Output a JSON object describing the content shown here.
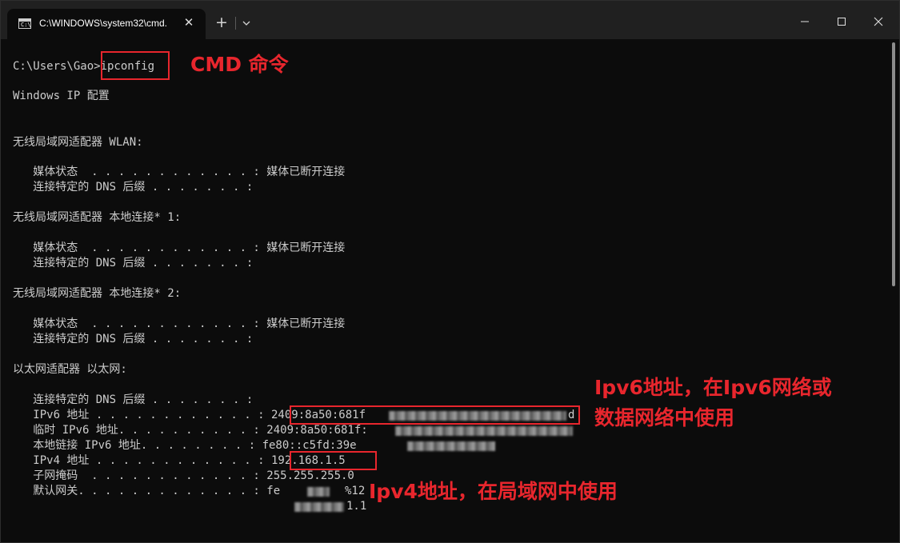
{
  "window": {
    "tab_title": "C:\\WINDOWS\\system32\\cmd.",
    "tab_icon_glyph": "C:\\",
    "close_tab_glyph": "✕",
    "new_tab_glyph": "+"
  },
  "console": {
    "prompt": "C:\\Users\\Gao>",
    "command": "ipconfig",
    "lines": [
      {
        "text": "Windows IP 配置"
      },
      {
        "text": "无线局域网适配器 WLAN:"
      },
      {
        "text": "   媒体状态  . . . . . . . . . . . . : 媒体已断开连接"
      },
      {
        "text": "   连接特定的 DNS 后缀 . . . . . . . :"
      },
      {
        "text": "无线局域网适配器 本地连接* 1:"
      },
      {
        "text": "   媒体状态  . . . . . . . . . . . . : 媒体已断开连接"
      },
      {
        "text": "   连接特定的 DNS 后缀 . . . . . . . :"
      },
      {
        "text": "无线局域网适配器 本地连接* 2:"
      },
      {
        "text": "   媒体状态  . . . . . . . . . . . . : 媒体已断开连接"
      },
      {
        "text": "   连接特定的 DNS 后缀 . . . . . . . :"
      },
      {
        "text": "以太网适配器 以太网:"
      },
      {
        "text": "   连接特定的 DNS 后缀 . . . . . . . :"
      },
      {
        "text": "   IPv6 地址 . . . . . . . . . . . . : 2409:8a50:681f"
      },
      {
        "text": "   临时 IPv6 地址. . . . . . . . . . : 2409:8a50:681f:"
      },
      {
        "text": "   本地链接 IPv6 地址. . . . . . . . : fe80::c5fd:39e"
      },
      {
        "text": "   IPv4 地址 . . . . . . . . . . . . : 192.168.1.5"
      },
      {
        "text": "   子网掩码  . . . . . . . . . . . . : 255.255.255.0"
      },
      {
        "text": "   默认网关. . . . . . . . . . . . . : fe"
      },
      {
        "text": "%12"
      },
      {
        "text": "1.1"
      }
    ],
    "ipv6_suffix": "d"
  },
  "annotations": {
    "cmd_label": "CMD 命令",
    "ipv6_line1": "Ipv6地址，在Ipv6网络或",
    "ipv6_line2": "数据网络中使用",
    "ipv4_label": "Ipv4地址，在局域网中使用",
    "accent_color": "#e8262d"
  },
  "icons": {
    "tab": "terminal-icon",
    "close_tab": "close-icon",
    "new_tab": "plus-icon",
    "dropdown": "chevron-down-icon",
    "minimize": "minimize-icon",
    "maximize": "maximize-icon",
    "close_window": "close-icon"
  }
}
